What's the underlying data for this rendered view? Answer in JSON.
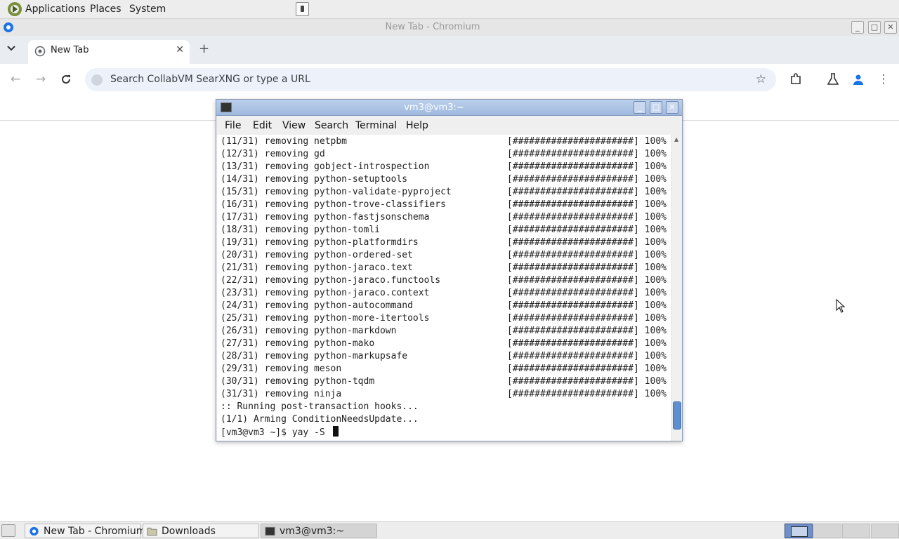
{
  "top_panel": {
    "menus": [
      "Applications",
      "Places",
      "System"
    ]
  },
  "chromium": {
    "window_title": "New Tab - Chromium",
    "tab_title": "New Tab",
    "omnibox_placeholder": "Search CollabVM SearXNG or type a URL"
  },
  "terminal": {
    "title": "vm3@vm3:~",
    "menus": [
      "File",
      "Edit",
      "View",
      "Search",
      "Terminal",
      "Help"
    ],
    "progress_bar": "[######################] 100%",
    "removals": [
      "(11/31) removing netpbm",
      "(12/31) removing gd",
      "(13/31) removing gobject-introspection",
      "(14/31) removing python-setuptools",
      "(15/31) removing python-validate-pyproject",
      "(16/31) removing python-trove-classifiers",
      "(17/31) removing python-fastjsonschema",
      "(18/31) removing python-tomli",
      "(19/31) removing python-platformdirs",
      "(20/31) removing python-ordered-set",
      "(21/31) removing python-jaraco.text",
      "(22/31) removing python-jaraco.functools",
      "(23/31) removing python-jaraco.context",
      "(24/31) removing python-autocommand",
      "(25/31) removing python-more-itertools",
      "(26/31) removing python-markdown",
      "(27/31) removing python-mako",
      "(28/31) removing python-markupsafe",
      "(29/31) removing meson",
      "(30/31) removing python-tqdm",
      "(31/31) removing ninja"
    ],
    "post_lines": [
      ":: Running post-transaction hooks...",
      "(1/1) Arming ConditionNeedsUpdate..."
    ],
    "prompt": "[vm3@vm3 ~]$ yay -S "
  },
  "taskbar": {
    "tasks": [
      "New Tab - Chromium",
      "Downloads",
      "vm3@vm3:~"
    ]
  },
  "colors": {
    "terminal_titlebar": "#9fb9de",
    "scroll_thumb": "#5f8fcf",
    "omnibox_bg": "#edf2fa"
  }
}
